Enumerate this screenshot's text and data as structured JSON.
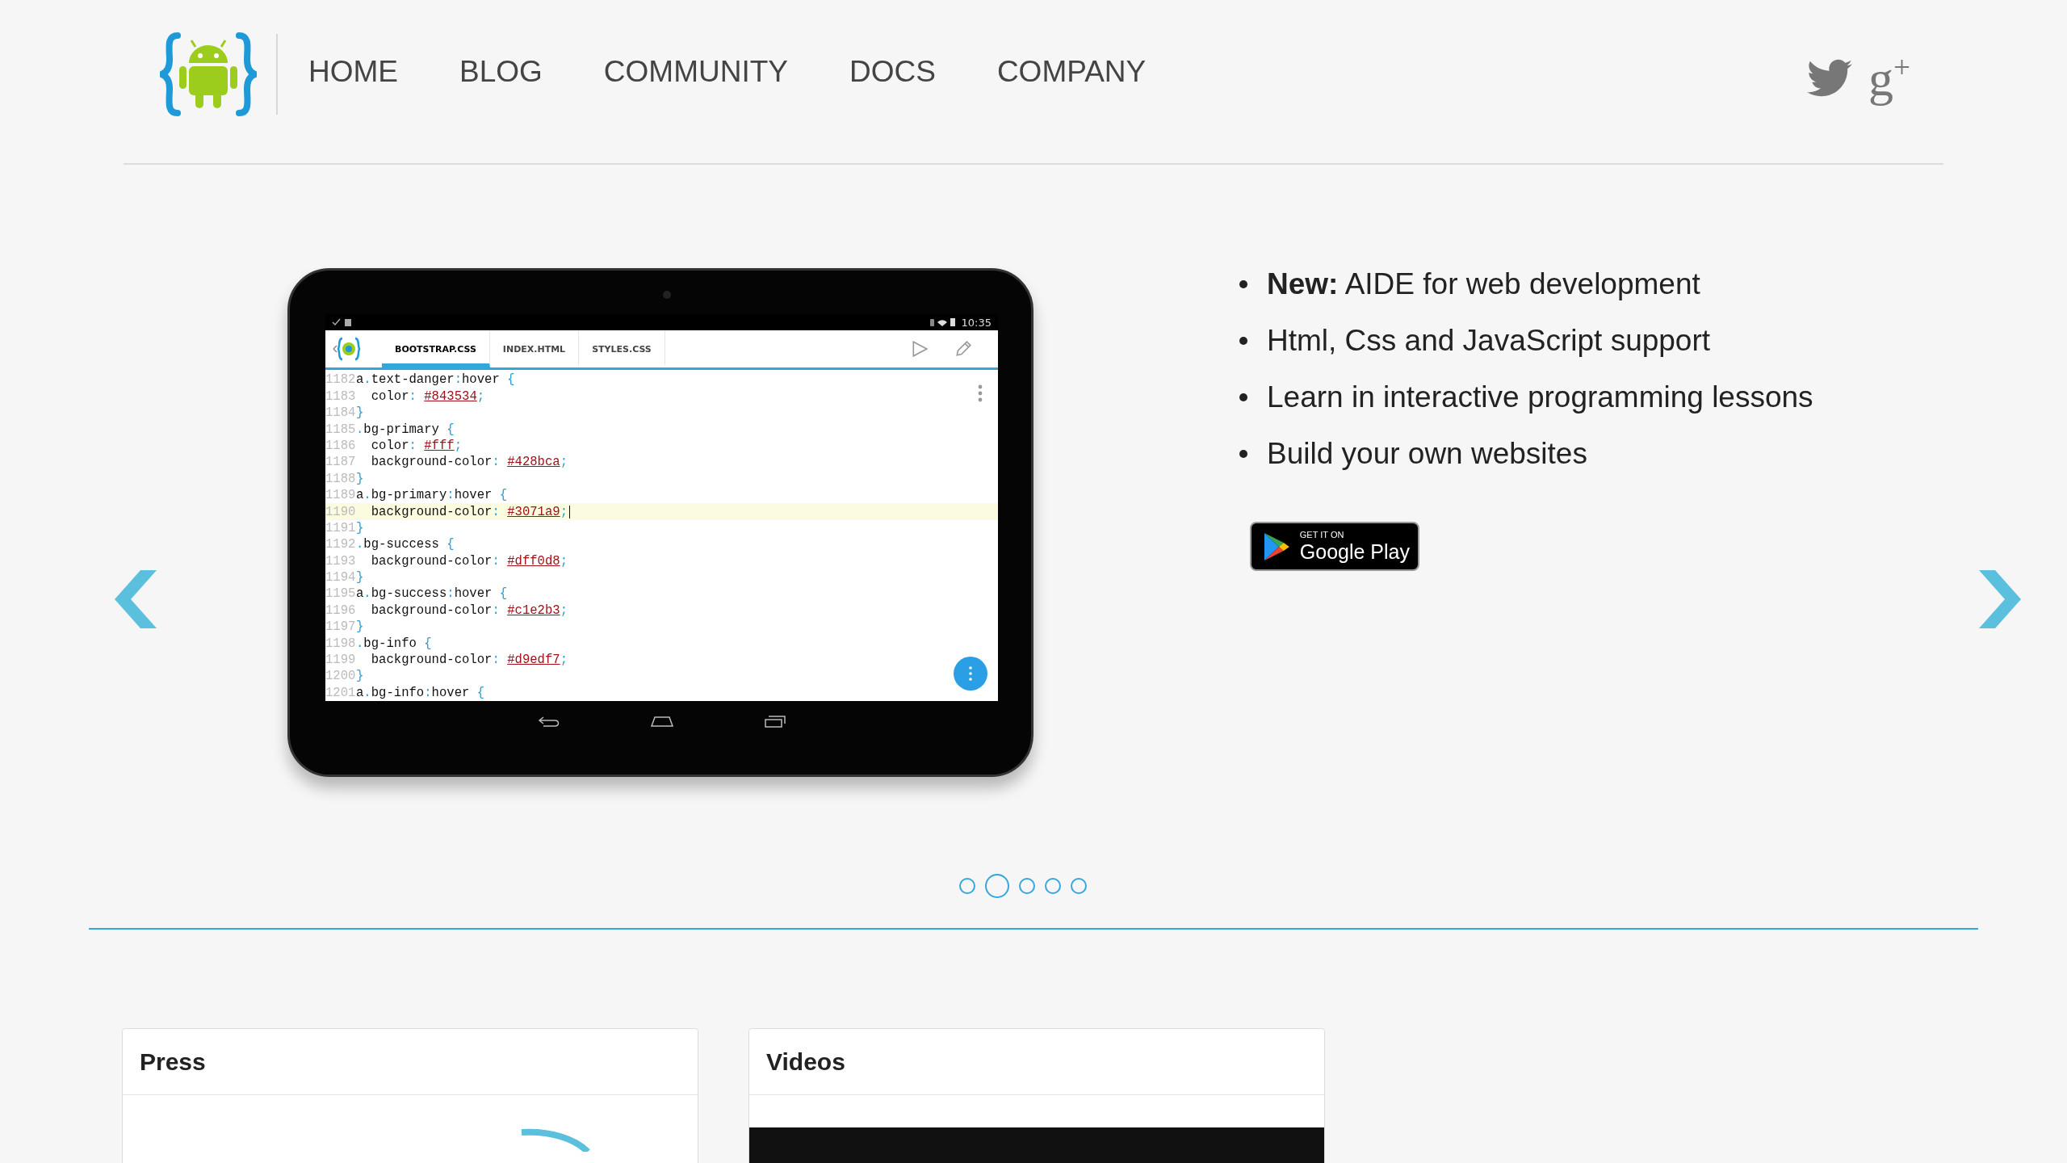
{
  "nav": {
    "items": [
      "HOME",
      "BLOG",
      "COMMUNITY",
      "DOCS",
      "COMPANY"
    ],
    "gplus": "g$^{+}$"
  },
  "slide": {
    "device": {
      "status_time": "10:35",
      "tabs": [
        {
          "label": "BOOTSTRAP.CSS",
          "selected": true
        },
        {
          "label": "INDEX.HTML",
          "selected": false
        },
        {
          "label": "STYLES.CSS",
          "selected": false
        }
      ],
      "lines": [
        {
          "num": "1182",
          "current": false,
          "segments": [
            {
              "kind": "sel",
              "text": "a"
            },
            {
              "kind": "punct",
              "text": "."
            },
            {
              "kind": "sel",
              "text": "text-danger"
            },
            {
              "kind": "punct",
              "text": ":"
            },
            {
              "kind": "sel",
              "text": "hover "
            },
            {
              "kind": "punct",
              "text": "{"
            }
          ]
        },
        {
          "num": "1183",
          "current": false,
          "segments": [
            {
              "kind": "prop",
              "text": "  color"
            },
            {
              "kind": "punct",
              "text": ": "
            },
            {
              "kind": "value",
              "text": "#843534"
            },
            {
              "kind": "punct",
              "text": ";"
            }
          ]
        },
        {
          "num": "1184",
          "current": false,
          "segments": [
            {
              "kind": "punct",
              "text": "}"
            }
          ]
        },
        {
          "num": "1185",
          "current": false,
          "segments": [
            {
              "kind": "punct",
              "text": "."
            },
            {
              "kind": "sel",
              "text": "bg-primary "
            },
            {
              "kind": "punct",
              "text": "{"
            }
          ]
        },
        {
          "num": "1186",
          "current": false,
          "segments": [
            {
              "kind": "prop",
              "text": "  color"
            },
            {
              "kind": "punct",
              "text": ": "
            },
            {
              "kind": "value",
              "text": "#fff"
            },
            {
              "kind": "punct",
              "text": ";"
            }
          ]
        },
        {
          "num": "1187",
          "current": false,
          "segments": [
            {
              "kind": "prop",
              "text": "  background-color"
            },
            {
              "kind": "punct",
              "text": ": "
            },
            {
              "kind": "value",
              "text": "#428bca"
            },
            {
              "kind": "punct",
              "text": ";"
            }
          ]
        },
        {
          "num": "1188",
          "current": false,
          "segments": [
            {
              "kind": "punct",
              "text": "}"
            }
          ]
        },
        {
          "num": "1189",
          "current": false,
          "segments": [
            {
              "kind": "sel",
              "text": "a"
            },
            {
              "kind": "punct",
              "text": "."
            },
            {
              "kind": "sel",
              "text": "bg-primary"
            },
            {
              "kind": "punct",
              "text": ":"
            },
            {
              "kind": "sel",
              "text": "hover "
            },
            {
              "kind": "punct",
              "text": "{"
            }
          ]
        },
        {
          "num": "1190",
          "current": true,
          "segments": [
            {
              "kind": "prop",
              "text": "  background-color"
            },
            {
              "kind": "punct",
              "text": ": "
            },
            {
              "kind": "value",
              "text": "#3071a9"
            },
            {
              "kind": "punct",
              "text": ";"
            }
          ]
        },
        {
          "num": "1191",
          "current": false,
          "segments": [
            {
              "kind": "punct",
              "text": "}"
            }
          ]
        },
        {
          "num": "1192",
          "current": false,
          "segments": [
            {
              "kind": "punct",
              "text": "."
            },
            {
              "kind": "sel",
              "text": "bg-success "
            },
            {
              "kind": "punct",
              "text": "{"
            }
          ]
        },
        {
          "num": "1193",
          "current": false,
          "segments": [
            {
              "kind": "prop",
              "text": "  background-color"
            },
            {
              "kind": "punct",
              "text": ": "
            },
            {
              "kind": "value",
              "text": "#dff0d8"
            },
            {
              "kind": "punct",
              "text": ";"
            }
          ]
        },
        {
          "num": "1194",
          "current": false,
          "segments": [
            {
              "kind": "punct",
              "text": "}"
            }
          ]
        },
        {
          "num": "1195",
          "current": false,
          "segments": [
            {
              "kind": "sel",
              "text": "a"
            },
            {
              "kind": "punct",
              "text": "."
            },
            {
              "kind": "sel",
              "text": "bg-success"
            },
            {
              "kind": "punct",
              "text": ":"
            },
            {
              "kind": "sel",
              "text": "hover "
            },
            {
              "kind": "punct",
              "text": "{"
            }
          ]
        },
        {
          "num": "1196",
          "current": false,
          "segments": [
            {
              "kind": "prop",
              "text": "  background-color"
            },
            {
              "kind": "punct",
              "text": ": "
            },
            {
              "kind": "value",
              "text": "#c1e2b3"
            },
            {
              "kind": "punct",
              "text": ";"
            }
          ]
        },
        {
          "num": "1197",
          "current": false,
          "segments": [
            {
              "kind": "punct",
              "text": "}"
            }
          ]
        },
        {
          "num": "1198",
          "current": false,
          "segments": [
            {
              "kind": "punct",
              "text": "."
            },
            {
              "kind": "sel",
              "text": "bg-info "
            },
            {
              "kind": "punct",
              "text": "{"
            }
          ]
        },
        {
          "num": "1199",
          "current": false,
          "segments": [
            {
              "kind": "prop",
              "text": "  background-color"
            },
            {
              "kind": "punct",
              "text": ": "
            },
            {
              "kind": "value",
              "text": "#d9edf7"
            },
            {
              "kind": "punct",
              "text": ";"
            }
          ]
        },
        {
          "num": "1200",
          "current": false,
          "segments": [
            {
              "kind": "punct",
              "text": "}"
            }
          ]
        },
        {
          "num": "1201",
          "current": false,
          "segments": [
            {
              "kind": "sel",
              "text": "a"
            },
            {
              "kind": "punct",
              "text": "."
            },
            {
              "kind": "sel",
              "text": "bg-info"
            },
            {
              "kind": "punct",
              "text": ":"
            },
            {
              "kind": "sel",
              "text": "hover "
            },
            {
              "kind": "punct",
              "text": "{"
            }
          ]
        }
      ]
    },
    "features": [
      "**New:** AIDE for web development",
      "Html, Css and JavaScript support",
      "Learn in interactive programming lessons",
      "Build your own websites"
    ],
    "store_badge": {
      "small": "GET IT ON",
      "large": "Google Play"
    }
  },
  "carousel_dots": [
    {
      "selected": false
    },
    {
      "selected": true
    },
    {
      "selected": false
    },
    {
      "selected": false
    },
    {
      "selected": false
    }
  ],
  "cards": [
    {
      "title": "Press",
      "kind": "press"
    },
    {
      "title": "Videos",
      "kind": "video"
    }
  ]
}
